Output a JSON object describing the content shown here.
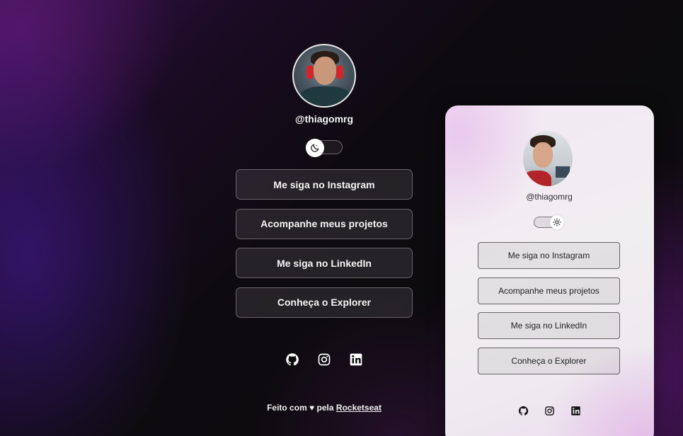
{
  "profile": {
    "username": "@thiagomrg",
    "avatar_alt": "Profile photo"
  },
  "theme_toggle": {
    "dark_icon": "moon-icon",
    "light_icon": "sun-icon"
  },
  "links": [
    {
      "label": "Me siga no Instagram"
    },
    {
      "label": "Acompanhe meus projetos"
    },
    {
      "label": "Me siga no LinkedIn"
    },
    {
      "label": "Conheça o Explorer"
    }
  ],
  "social": [
    {
      "icon": "github-icon"
    },
    {
      "icon": "instagram-icon"
    },
    {
      "icon": "linkedin-icon"
    }
  ],
  "footer": {
    "prefix": "Feito com",
    "heart": "♥",
    "middle": "pela",
    "link_label": "Rocketseat"
  },
  "colors": {
    "dark_bg": "#0c0b0d",
    "accent_purple": "#3a1450",
    "light_card_bg": "#f1eef1"
  }
}
